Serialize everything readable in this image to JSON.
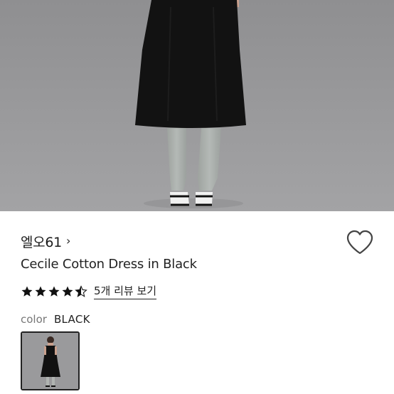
{
  "product": {
    "brand": "엘오61",
    "brand_chevron": "›",
    "title": "Cecile Cotton Dress in Black",
    "rating": 4.5,
    "rating_max": 5,
    "review_link": "5개 리뷰 보기",
    "color_label": "color",
    "color_value": "BLACK"
  },
  "icons": {
    "wishlist": "heart-outline-icon",
    "star": "star-icon"
  },
  "colors": {
    "hero_background": "#959597",
    "dress": "#111111",
    "socks": "#a9aeab",
    "text": "#222222",
    "muted": "#777777"
  }
}
